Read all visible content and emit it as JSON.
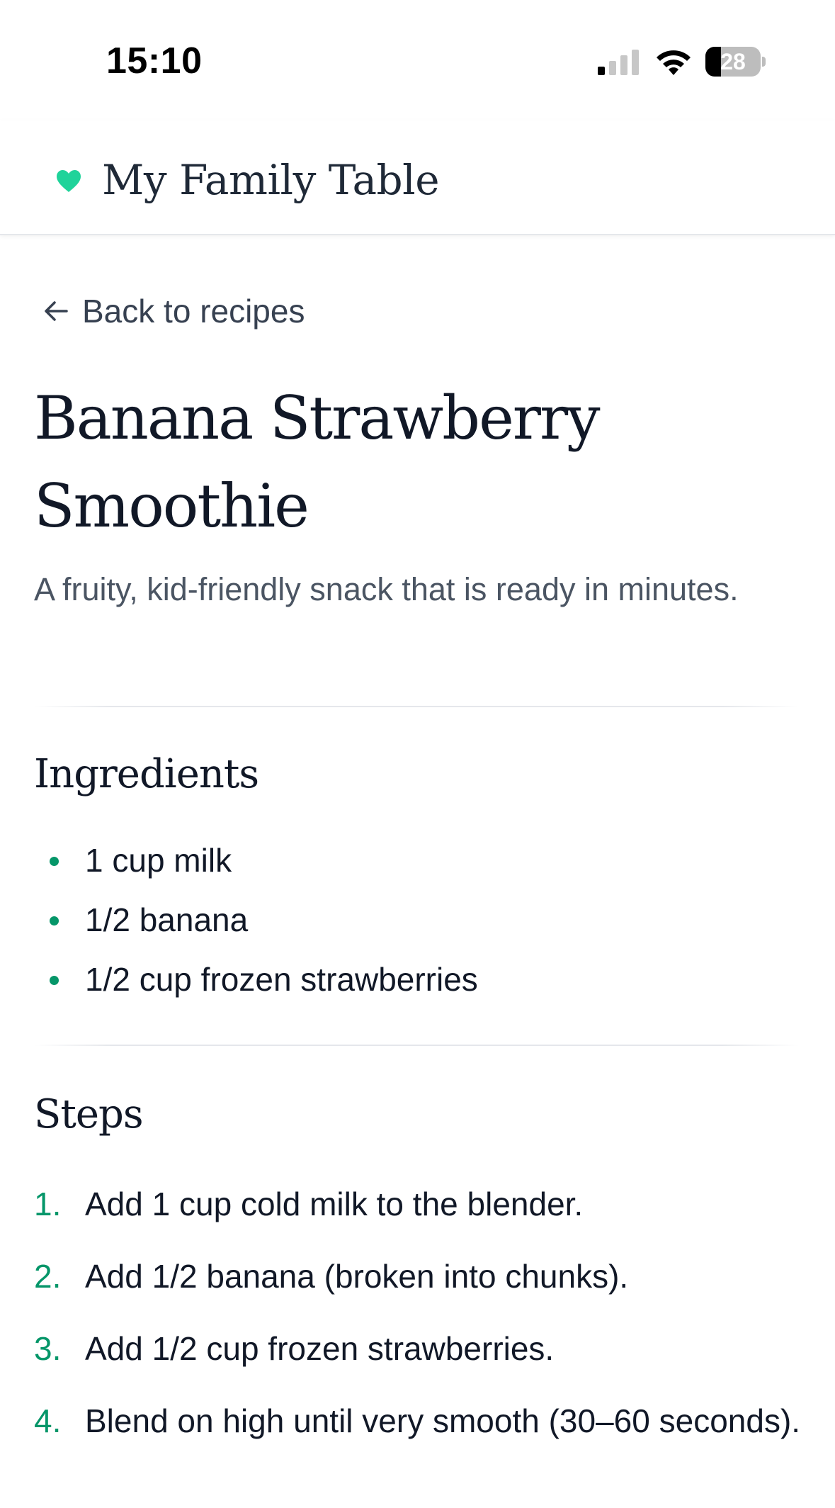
{
  "status_bar": {
    "time": "15:10",
    "battery_level": "28",
    "battery_fraction": 0.28,
    "signal_bars_active": 1,
    "signal_bars_total": 4
  },
  "header": {
    "icon": "heart-icon",
    "title": "My Family Table",
    "accent_color": "#1fd39a"
  },
  "back_link": {
    "icon": "arrow-left-icon",
    "label": "Back to recipes"
  },
  "recipe": {
    "title": "Banana Strawberry Smoothie",
    "description": "A fruity, kid-friendly snack that is ready in minutes."
  },
  "ingredients": {
    "heading": "Ingredients",
    "items": [
      "1 cup milk",
      "1/2 banana",
      "1/2 cup frozen strawberries"
    ]
  },
  "steps": {
    "heading": "Steps",
    "items": [
      {
        "number": "1.",
        "text": "Add 1 cup cold milk to the blender."
      },
      {
        "number": "2.",
        "text": "Add 1/2 banana (broken into chunks)."
      },
      {
        "number": "3.",
        "text": "Add 1/2 cup frozen strawberries."
      },
      {
        "number": "4.",
        "text": "Blend on high until very smooth (30–60 seconds)."
      }
    ]
  },
  "colors": {
    "list_marker": "#059669",
    "body_text": "#111827",
    "muted_text": "#4b5563"
  }
}
